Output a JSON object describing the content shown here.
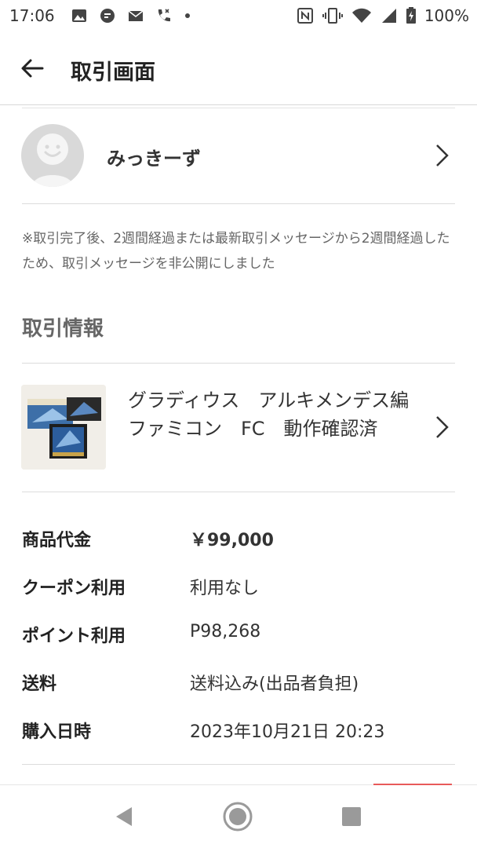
{
  "status": {
    "time": "17:06",
    "battery": "100%",
    "left_icons": [
      "image-icon",
      "chat-icon",
      "mail-icon",
      "missed-call-icon",
      "dot-icon"
    ],
    "right_icons": [
      "nfc-icon",
      "vibrate-icon",
      "wifi-icon",
      "signal-icon",
      "battery-icon"
    ]
  },
  "header": {
    "title": "取引画面"
  },
  "user": {
    "name": "みっきーず"
  },
  "notice": "※取引完了後、2週間経過または最新取引メッセージから2週間経過したため、取引メッセージを非公開にしました",
  "transaction": {
    "section_title": "取引情報",
    "item_title": "グラディウス　アルキメンデス編　ファミコン　FC　動作確認済",
    "rows": [
      {
        "label": "商品代金",
        "value": "￥99,000"
      },
      {
        "label": "クーポン利用",
        "value": "利用なし"
      },
      {
        "label": "ポイント利用",
        "value": "P98,268"
      },
      {
        "label": "送料",
        "value": "送料込み(出品者負担)"
      },
      {
        "label": "購入日時",
        "value": "2023年10月21日 20:23"
      }
    ]
  },
  "colors": {
    "accent_red": "#e85a5a",
    "text_dark": "#222222",
    "text_gray": "#666666"
  }
}
